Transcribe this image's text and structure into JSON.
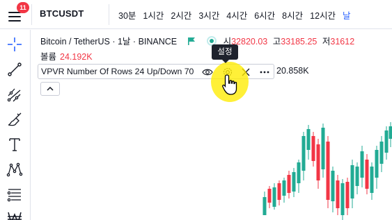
{
  "topbar": {
    "notification_count": "11",
    "symbol": "BTCUSDT",
    "intervals": [
      "30분",
      "1시간",
      "2시간",
      "3시간",
      "4시간",
      "6시간",
      "8시간",
      "12시간",
      "날"
    ],
    "active_interval_index": 8
  },
  "legend": {
    "pair": "Bitcoin / TetherUS",
    "sep1": "·",
    "timeframe": "1날",
    "sep2": "·",
    "exchange": "BINANCE",
    "open_label": "시",
    "open_value": "32820.03",
    "high_label": "고",
    "high_value": "33185.25",
    "low_label": "저",
    "low_value": "31612",
    "volume_label": "볼륨",
    "volume_value": "24.192K"
  },
  "indicator": {
    "name": "VPVR Number Of Rows 24 Up/Down 70",
    "value": "20.858K"
  },
  "tooltip": {
    "text": "설정"
  },
  "colors": {
    "up": "#22ab94",
    "down": "#f23645",
    "accent": "#2962ff",
    "cursor_highlight": "#ffec00"
  },
  "icons": {
    "menu": "hamburger-menu-icon",
    "crosshair": "crosshair-icon",
    "trendline": "trend-line-icon",
    "pitchfork": "pitchfork-icon",
    "brush": "brush-icon",
    "text": "text-icon",
    "pattern": "pattern-icon",
    "fib": "fib-levels-icon",
    "currency": "won-currency-icon",
    "eye": "eye-icon",
    "settings": "gear-icon",
    "close": "close-icon",
    "more": "more-icon",
    "collapse": "chevron-up-icon",
    "flag": "green-flag-icon",
    "live": "live-status-dot",
    "hand": "hand-cursor-icon"
  }
}
